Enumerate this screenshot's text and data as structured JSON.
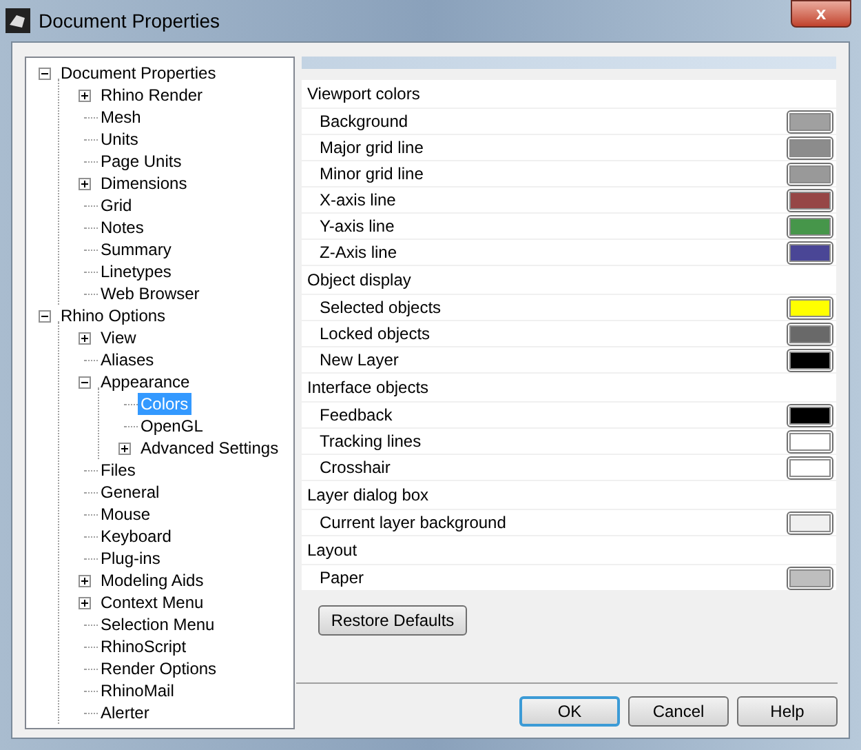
{
  "window": {
    "title": "Document Properties",
    "close": "x"
  },
  "tree": [
    {
      "label": "Document Properties",
      "expanded": true,
      "selected": false,
      "children": [
        {
          "label": "Rhino Render",
          "expanded": false,
          "selected": false
        },
        {
          "label": "Mesh",
          "selected": false
        },
        {
          "label": "Units",
          "selected": false
        },
        {
          "label": "Page Units",
          "selected": false
        },
        {
          "label": "Dimensions",
          "expanded": false,
          "selected": false
        },
        {
          "label": "Grid",
          "selected": false
        },
        {
          "label": "Notes",
          "selected": false
        },
        {
          "label": "Summary",
          "selected": false
        },
        {
          "label": "Linetypes",
          "selected": false
        },
        {
          "label": "Web Browser",
          "selected": false
        }
      ]
    },
    {
      "label": "Rhino Options",
      "expanded": true,
      "selected": false,
      "children": [
        {
          "label": "View",
          "expanded": false,
          "selected": false
        },
        {
          "label": "Aliases",
          "selected": false
        },
        {
          "label": "Appearance",
          "expanded": true,
          "selected": false,
          "children": [
            {
              "label": "Colors",
              "selected": true
            },
            {
              "label": "OpenGL",
              "selected": false
            },
            {
              "label": "Advanced Settings",
              "expanded": false,
              "selected": false
            }
          ]
        },
        {
          "label": "Files",
          "selected": false
        },
        {
          "label": "General",
          "selected": false
        },
        {
          "label": "Mouse",
          "selected": false
        },
        {
          "label": "Keyboard",
          "selected": false
        },
        {
          "label": "Plug-ins",
          "selected": false
        },
        {
          "label": "Modeling Aids",
          "expanded": false,
          "selected": false
        },
        {
          "label": "Context Menu",
          "expanded": false,
          "selected": false
        },
        {
          "label": "Selection Menu",
          "selected": false
        },
        {
          "label": "RhinoScript",
          "selected": false
        },
        {
          "label": "Render Options",
          "selected": false
        },
        {
          "label": "RhinoMail",
          "selected": false
        },
        {
          "label": "Alerter",
          "selected": false
        }
      ]
    }
  ],
  "sections": [
    {
      "title": "Viewport colors",
      "items": [
        {
          "label": "Background",
          "color": "#a0a0a0"
        },
        {
          "label": "Major grid line",
          "color": "#8c8c8c"
        },
        {
          "label": "Minor grid line",
          "color": "#999999"
        },
        {
          "label": "X-axis line",
          "color": "#964646"
        },
        {
          "label": "Y-axis line",
          "color": "#46964a"
        },
        {
          "label": "Z-Axis line",
          "color": "#4a4696"
        }
      ]
    },
    {
      "title": "Object display",
      "items": [
        {
          "label": "Selected objects",
          "color": "#ffff00"
        },
        {
          "label": "Locked objects",
          "color": "#696969"
        },
        {
          "label": "New Layer",
          "color": "#000000"
        }
      ]
    },
    {
      "title": "Interface objects",
      "items": [
        {
          "label": "Feedback",
          "color": "#000000"
        },
        {
          "label": "Tracking lines",
          "color": "#ffffff"
        },
        {
          "label": "Crosshair",
          "color": "#ffffff"
        }
      ]
    },
    {
      "title": "Layer dialog box",
      "items": [
        {
          "label": "Current layer background",
          "color": "#f0f0f0"
        }
      ]
    },
    {
      "title": "Layout",
      "items": [
        {
          "label": "Paper",
          "color": "#bebebe"
        }
      ]
    }
  ],
  "restore_button": "Restore Defaults",
  "buttons": [
    {
      "label": "OK",
      "default": true
    },
    {
      "label": "Cancel",
      "default": false
    },
    {
      "label": "Help",
      "default": false
    }
  ]
}
